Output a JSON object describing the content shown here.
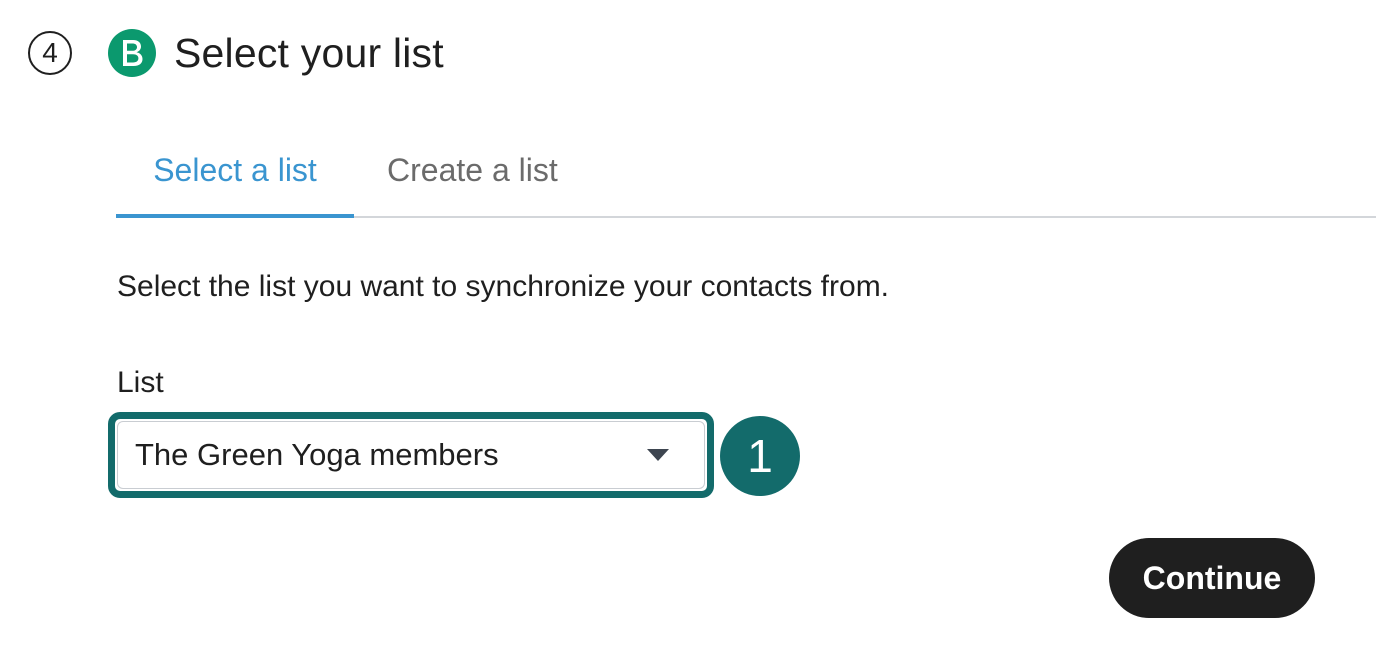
{
  "step": {
    "number": "4",
    "logo_icon": "brevo-b-icon",
    "title": "Select your list"
  },
  "colors": {
    "brand_green": "#0b996e",
    "active_tab": "#3a95d0",
    "highlight_teal": "#136b6b",
    "button_dark": "#1f1f1f"
  },
  "tabs": [
    {
      "label": "Select a list",
      "active": true
    },
    {
      "label": "Create a list",
      "active": false
    }
  ],
  "description": "Select the list you want to synchronize your contacts from.",
  "list_field": {
    "label": "List",
    "selected_value": "The Green Yoga members",
    "caret_icon": "caret-down-icon"
  },
  "annotation_badge": "1",
  "continue_label": "Continue"
}
